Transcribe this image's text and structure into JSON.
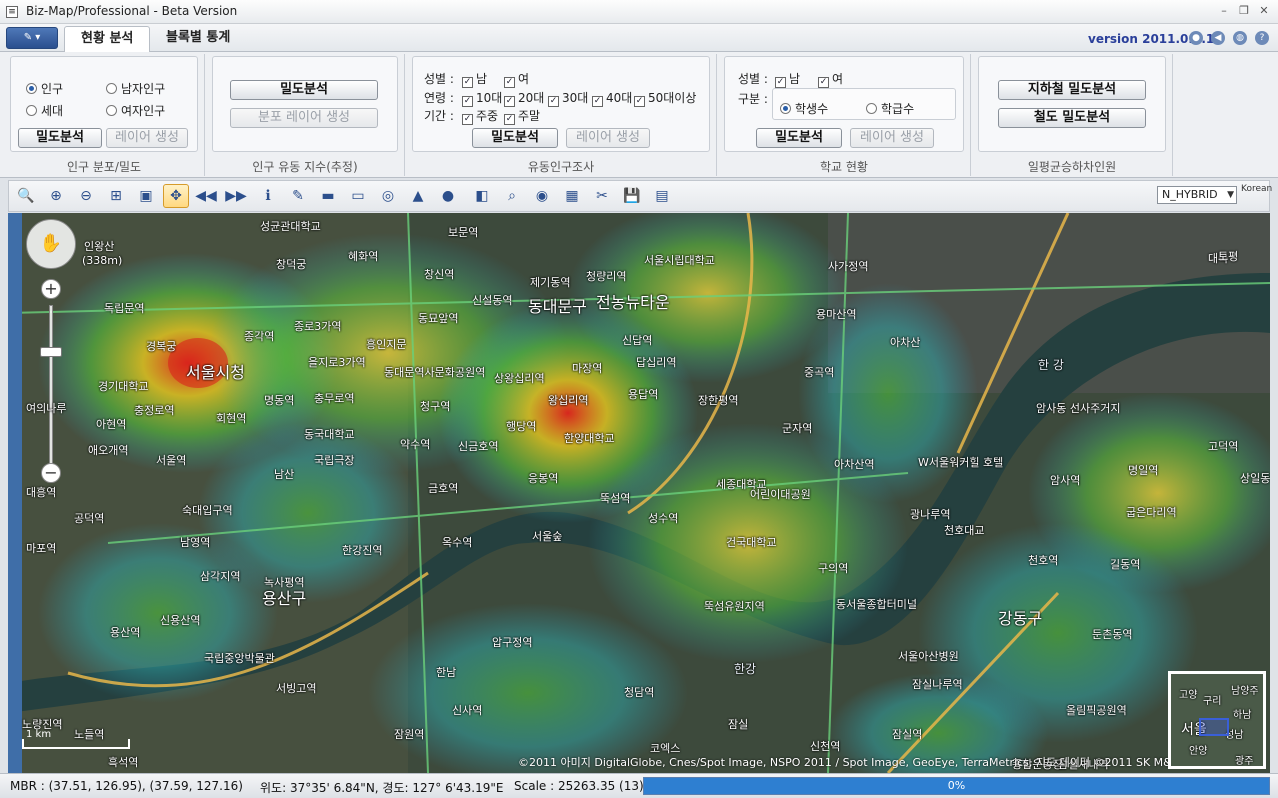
{
  "window": {
    "title": "Biz-Map/Professional - Beta Version",
    "controls": [
      "–",
      "❐",
      "✕"
    ]
  },
  "tabs": [
    {
      "label": "현황 분석",
      "active": true
    },
    {
      "label": "블록별 통계",
      "active": false
    }
  ],
  "version": "version 2011.0.0.1",
  "ribbon": {
    "population": {
      "options": [
        {
          "label": "인구",
          "selected": true
        },
        {
          "label": "남자인구",
          "selected": false
        },
        {
          "label": "세대",
          "selected": false
        },
        {
          "label": "여자인구",
          "selected": false
        }
      ],
      "analyze_button": "밀도분석",
      "layer_button": "레이어 생성",
      "group_label": "인구 분포/밀도"
    },
    "flow_index": {
      "analyze_button": "밀도분석",
      "layer_button": "분포 레이어 생성",
      "group_label": "인구 유동 지수(추정)"
    },
    "floating_survey": {
      "gender_label": "성별 :",
      "gender": [
        "남",
        "여"
      ],
      "age_label": "연령 :",
      "ages": [
        "10대",
        "20대",
        "30대",
        "40대",
        "50대이상"
      ],
      "period_label": "기간 :",
      "periods": [
        "주중",
        "주말"
      ],
      "analyze_button": "밀도분석",
      "layer_button": "레이어 생성",
      "group_label": "유동인구조사"
    },
    "school": {
      "gender_label": "성별 :",
      "gender": [
        "남",
        "여"
      ],
      "type_label": "구분 :",
      "types": [
        {
          "label": "학생수",
          "selected": true
        },
        {
          "label": "학급수",
          "selected": false
        }
      ],
      "analyze_button": "밀도분석",
      "layer_button": "레이어 생성",
      "group_label": "학교 현황"
    },
    "transit": {
      "subway_button": "지하철 밀도분석",
      "rail_button": "철도 밀도분석",
      "group_label": "일평균승하차인원"
    }
  },
  "toolbar": {
    "tools": [
      "magnify-icon",
      "zoom-in-icon",
      "zoom-out-icon",
      "zoom-box-icon",
      "select-box-icon",
      "pan-icon",
      "previous-extent-icon",
      "next-extent-icon",
      "info-icon",
      "pen-icon",
      "measure-distance-icon",
      "measure-area-icon",
      "buffer-icon",
      "graph-icon",
      "globe-icon",
      "layer-icon",
      "search-icon",
      "overlay-icon",
      "map-icon",
      "tools-icon",
      "save-icon",
      "print-icon"
    ],
    "map_type": "N_HYBRID",
    "language": "Korean"
  },
  "map": {
    "places": [
      {
        "label": "성균관대학교"
      },
      {
        "label": "혜화역"
      },
      {
        "label": "보문역"
      },
      {
        "label": "창신역"
      },
      {
        "label": "제기동역"
      },
      {
        "label": "청량리역"
      },
      {
        "label": "서울시립대학교"
      },
      {
        "label": "사가정역"
      },
      {
        "label": "창덕궁"
      },
      {
        "label": "신설동역"
      },
      {
        "label": "동대문구"
      },
      {
        "label": "전농뉴타운"
      },
      {
        "label": "인왕산"
      },
      {
        "label": "(338m)"
      },
      {
        "label": "독립문역"
      },
      {
        "label": "종로3가역"
      },
      {
        "label": "동묘앞역"
      },
      {
        "label": "용마산역"
      },
      {
        "label": "아차산"
      },
      {
        "label": "경복궁"
      },
      {
        "label": "종각역"
      },
      {
        "label": "을지로3가역"
      },
      {
        "label": "흥인지문"
      },
      {
        "label": "신답역"
      },
      {
        "label": "서울시청"
      },
      {
        "label": "동대문역사문화공원역"
      },
      {
        "label": "상왕십리역"
      },
      {
        "label": "마장역"
      },
      {
        "label": "답십리역"
      },
      {
        "label": "중곡역"
      },
      {
        "label": "한 강"
      },
      {
        "label": "경기대학교"
      },
      {
        "label": "명동역"
      },
      {
        "label": "충무로역"
      },
      {
        "label": "청구역"
      },
      {
        "label": "왕십리역"
      },
      {
        "label": "용답역"
      },
      {
        "label": "장한평역"
      },
      {
        "label": "충정로역"
      },
      {
        "label": "회현역"
      },
      {
        "label": "동국대학교"
      },
      {
        "label": "한양대학교"
      },
      {
        "label": "군자역"
      },
      {
        "label": "신금호역"
      },
      {
        "label": "행당역"
      },
      {
        "label": "아현역"
      },
      {
        "label": "약수역"
      },
      {
        "label": "국립극장"
      },
      {
        "label": "서울역"
      },
      {
        "label": "아차산역"
      },
      {
        "label": "W서울워커힐 호텔"
      },
      {
        "label": "애오개역"
      },
      {
        "label": "남산"
      },
      {
        "label": "금호역"
      },
      {
        "label": "응봉역"
      },
      {
        "label": "세종대학교"
      },
      {
        "label": "어린이대공원"
      },
      {
        "label": "공덕역"
      },
      {
        "label": "숙대입구역"
      },
      {
        "label": "뚝섬역"
      },
      {
        "label": "성수역"
      },
      {
        "label": "광나루역"
      },
      {
        "label": "남영역"
      },
      {
        "label": "옥수역"
      },
      {
        "label": "서울숲"
      },
      {
        "label": "건국대학교"
      },
      {
        "label": "천호대교"
      },
      {
        "label": "한강진역"
      },
      {
        "label": "삼각지역"
      },
      {
        "label": "구의역"
      },
      {
        "label": "천호역"
      },
      {
        "label": "녹사평역"
      },
      {
        "label": "용산구"
      },
      {
        "label": "신용산역"
      },
      {
        "label": "뚝섬유원지역"
      },
      {
        "label": "동서울종합터미널"
      },
      {
        "label": "용산역"
      },
      {
        "label": "국립중앙박물관"
      },
      {
        "label": "압구정역"
      },
      {
        "label": "서울아산병원"
      },
      {
        "label": "신사역"
      },
      {
        "label": "청담역"
      },
      {
        "label": "잠실나루역"
      },
      {
        "label": "한남"
      },
      {
        "label": "잠원역"
      },
      {
        "label": "잠실"
      },
      {
        "label": "잠실역"
      },
      {
        "label": "한강"
      },
      {
        "label": "서빙고역"
      },
      {
        "label": "노들역"
      },
      {
        "label": "흑석역"
      },
      {
        "label": "올림픽공원역"
      },
      {
        "label": "강동구"
      },
      {
        "label": "둔촌동역"
      },
      {
        "label": "길동역"
      },
      {
        "label": "명일역"
      },
      {
        "label": "고덕역"
      },
      {
        "label": "상일동역"
      },
      {
        "label": "암사역"
      },
      {
        "label": "암사동 선사주거지"
      },
      {
        "label": "굽은다리역"
      },
      {
        "label": "마포역"
      },
      {
        "label": "대흥역"
      },
      {
        "label": "여의나루"
      },
      {
        "label": "노량진역"
      },
      {
        "label": "코엑스"
      },
      {
        "label": "신천역"
      },
      {
        "label": "종합운동장"
      },
      {
        "label": "대곡"
      },
      {
        "label": "잠실새내역"
      },
      {
        "label": "토평"
      }
    ],
    "copyright": "©2011 아미지 DigitalGlobe, Cnes/Spot Image, NSPO 2011 / Spot Image, GeoEye, TerraMetrics, 지도 데이터 ©2011 SK M&C - 이용약관",
    "minimap_places": [
      {
        "label": "고양"
      },
      {
        "label": "구리"
      },
      {
        "label": "남양주"
      },
      {
        "label": "하남"
      },
      {
        "label": "서울"
      },
      {
        "label": "성남"
      },
      {
        "label": "안양"
      },
      {
        "label": "광주"
      }
    ],
    "scale_label": "1 km"
  },
  "status": {
    "mbr": "MBR : (37.51, 126.95), (37.59, 127.16)",
    "coords": "위도: 37°35' 6.84\"N, 경도: 127° 6'43.19\"E",
    "scale": "Scale : 25263.35 (13)",
    "progress_label": "0%",
    "progress": 0
  },
  "colors": {
    "accent": "#2a3f9a",
    "progress": "#2e7fd1"
  }
}
